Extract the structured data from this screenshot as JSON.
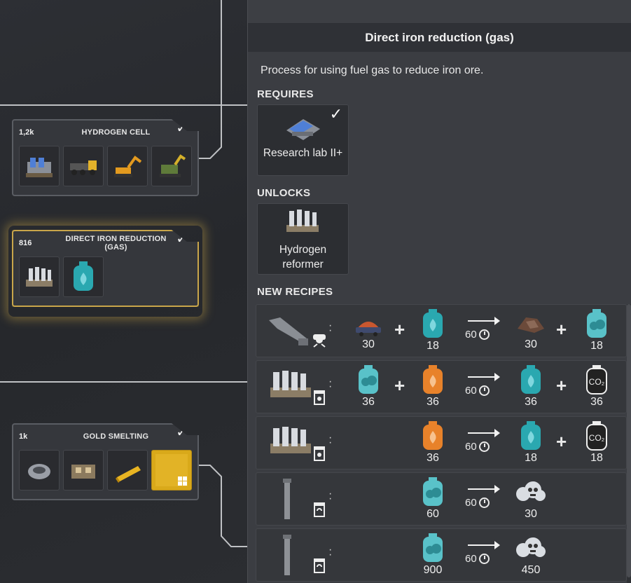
{
  "tree": {
    "nodes": [
      {
        "count": "1,2k",
        "title": "HYDROGEN CELL",
        "completed": true,
        "icons": [
          "hydrogen-cell-building-icon",
          "mining-truck-icon",
          "excavator-icon",
          "tree-harvester-icon"
        ]
      },
      {
        "count": "816",
        "title": "DIRECT IRON REDUCTION (GAS)",
        "completed": true,
        "selected": true,
        "icons": [
          "hydrogen-reformer-icon",
          "fuel-gas-canister-icon"
        ]
      },
      {
        "count": "1k",
        "title": "GOLD SMELTING",
        "completed": true,
        "icons": [
          "smelter-icon",
          "furnace-icon",
          "gold-bar-icon",
          "gold-sheet-icon"
        ]
      }
    ]
  },
  "panel": {
    "title": "Direct iron reduction (gas)",
    "description": "Process for using fuel gas to reduce iron ore.",
    "requires_label": "REQUIRES",
    "requires": [
      {
        "label": "Research lab II+",
        "completed": true,
        "icon": "research-lab-icon"
      }
    ],
    "unlocks_label": "UNLOCKS",
    "unlocks": [
      {
        "label_line1": "Hydrogen",
        "label_line2": "reformer",
        "icon": "hydrogen-reformer-icon"
      }
    ],
    "new_recipes_label": "NEW RECIPES",
    "recipes": [
      {
        "machine": "blast-furnace-icon",
        "inputs": [
          {
            "icon": "iron-ore-icon",
            "qty": "30"
          },
          {
            "icon": "fuel-gas-icon",
            "qty": "18"
          }
        ],
        "duration": "60",
        "outputs": [
          {
            "icon": "iron-sponge-icon",
            "qty": "30"
          },
          {
            "icon": "steam-gas-icon",
            "qty": "18"
          }
        ]
      },
      {
        "machine": "hydrogen-reformer-icon",
        "inputs": [
          {
            "icon": "steam-gas-icon",
            "qty": "36"
          },
          {
            "icon": "fuel-gas-orange-icon",
            "qty": "36"
          }
        ],
        "duration": "60",
        "outputs": [
          {
            "icon": "hydrogen-gas-icon",
            "qty": "36"
          },
          {
            "icon": "co2-icon",
            "qty": "36"
          }
        ]
      },
      {
        "machine": "hydrogen-reformer-icon",
        "inputs": [
          {
            "icon": "fuel-gas-orange-icon",
            "qty": "36"
          }
        ],
        "duration": "60",
        "outputs": [
          {
            "icon": "hydrogen-gas-icon",
            "qty": "18"
          },
          {
            "icon": "co2-icon",
            "qty": "18"
          }
        ]
      },
      {
        "machine": "exhaust-stack-icon",
        "inputs": [
          {
            "icon": "steam-gas-icon",
            "qty": "60"
          }
        ],
        "duration": "60",
        "outputs": [
          {
            "icon": "pollution-icon",
            "qty": "30"
          }
        ]
      },
      {
        "machine": "exhaust-stack-icon",
        "inputs": [
          {
            "icon": "steam-gas-icon",
            "qty": "900"
          }
        ],
        "duration": "60",
        "outputs": [
          {
            "icon": "pollution-icon",
            "qty": "450"
          }
        ]
      }
    ]
  },
  "colors": {
    "selected_glow": "#c9a64a",
    "panel_bg": "#3b3d42",
    "teal": "#2aa8b0",
    "orange": "#e8822a"
  }
}
